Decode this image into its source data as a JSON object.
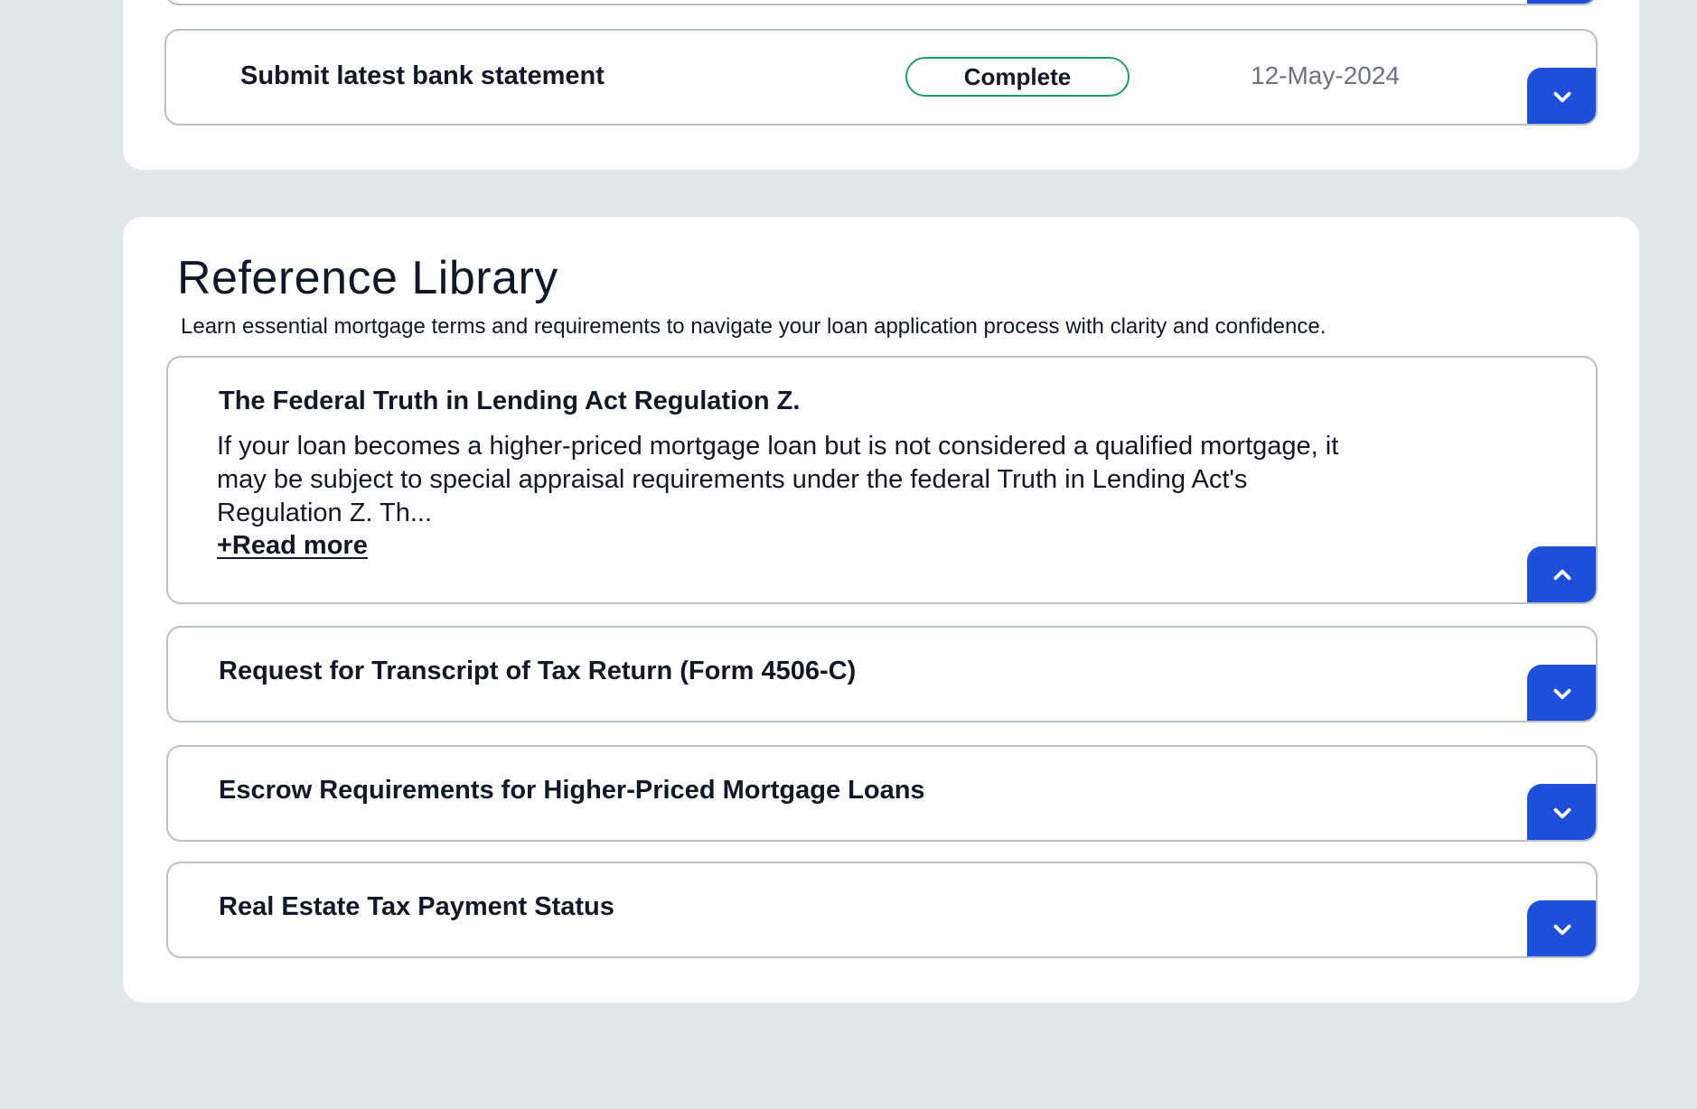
{
  "task_list": {
    "items": [
      {
        "title": "Submit latest bank statement",
        "status": "Complete",
        "date": "12-May-2024",
        "toggle_icon": "chevron-down-icon"
      }
    ]
  },
  "reference_library": {
    "title": "Reference Library",
    "subtitle": "Learn essential mortgage terms and requirements to navigate your loan application process with clarity and confidence.",
    "items": [
      {
        "title": "The Federal Truth in Lending Act Regulation Z.",
        "body": "If your loan becomes a higher-priced mortgage loan but is not considered a qualified mortgage, it may be subject to special appraisal requirements under the federal Truth in Lending Act's Regulation Z. Th...",
        "read_more": "+Read more",
        "expanded": true,
        "toggle_icon": "chevron-up-icon"
      },
      {
        "title": "Request for Transcript of Tax Return (Form 4506-C)",
        "expanded": false,
        "toggle_icon": "chevron-down-icon"
      },
      {
        "title": "Escrow Requirements for Higher-Priced Mortgage Loans",
        "expanded": false,
        "toggle_icon": "chevron-down-icon"
      },
      {
        "title": "Real Estate Tax Payment Status",
        "expanded": false,
        "toggle_icon": "chevron-down-icon"
      }
    ]
  },
  "colors": {
    "page_background": "#e2e7ea",
    "accent_blue": "#1f4fd8",
    "status_complete": "#1f9d63",
    "border": "#b9c0c6",
    "muted_text": "#6b7280"
  }
}
